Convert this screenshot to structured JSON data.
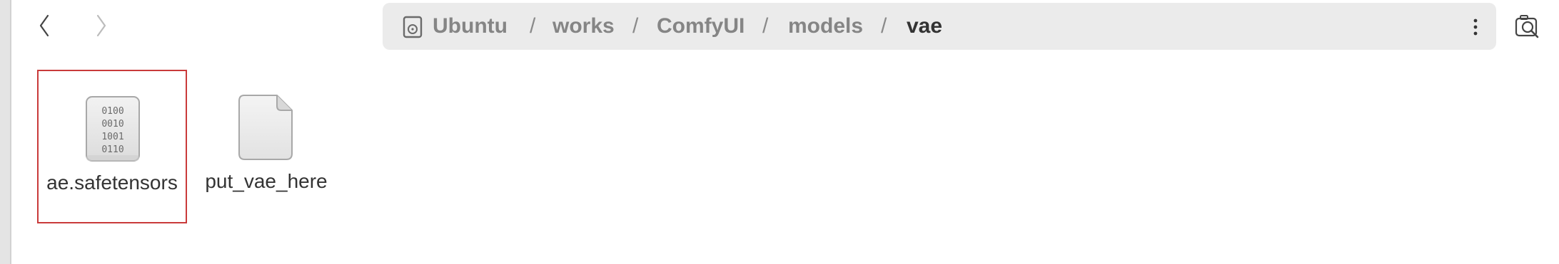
{
  "toolbar": {
    "back_icon": "chevron-left-icon",
    "forward_icon": "chevron-right-icon",
    "menu_icon": "vertical-ellipsis-icon",
    "search_icon": "search-icon"
  },
  "breadcrumb": {
    "root_icon": "drive-icon",
    "separator": "/",
    "items": [
      {
        "label": "Ubuntu"
      },
      {
        "label": "works"
      },
      {
        "label": "ComfyUI"
      },
      {
        "label": "models"
      },
      {
        "label": "vae"
      }
    ]
  },
  "files": [
    {
      "name": "ae.safetensors",
      "icon": "binary-file-icon",
      "selected": true
    },
    {
      "name": "put_vae_here",
      "icon": "text-file-icon",
      "selected": false
    }
  ],
  "colors": {
    "selection_border": "#c93a3a",
    "pathbar_bg": "#ebebeb",
    "text_dark": "#333333",
    "text_muted": "#858585"
  }
}
